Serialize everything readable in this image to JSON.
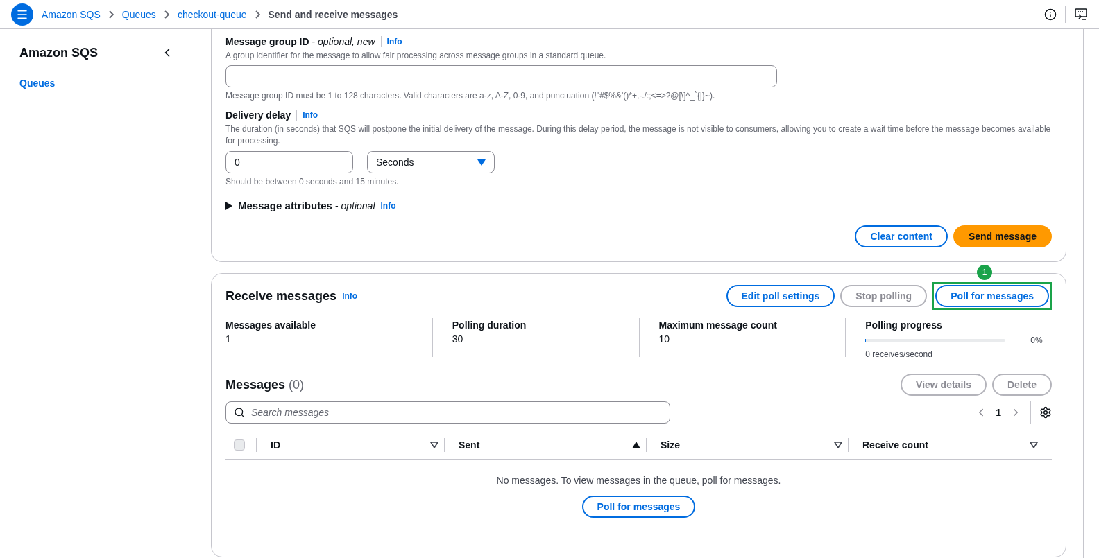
{
  "breadcrumbs": [
    {
      "label": "Amazon SQS",
      "link": true
    },
    {
      "label": "Queues",
      "link": true
    },
    {
      "label": "checkout-queue",
      "link": true
    },
    {
      "label": "Send and receive messages",
      "link": false
    }
  ],
  "sidebar": {
    "title": "Amazon SQS",
    "items": [
      {
        "label": "Queues",
        "selected": true
      }
    ]
  },
  "send_form": {
    "group_id": {
      "label": "Message group ID",
      "qualifier": "- *optional, new*",
      "info": "Info",
      "description": "A group identifier for the message to allow fair processing across message groups in a standard queue.",
      "constraint": "Message group ID must be 1 to 128 characters. Valid characters are a-z, A-Z, 0-9, and punctuation (!\"#$%&'()*+,-./:;<=>?@[\\]^_`{|}~)."
    },
    "delivery_delay": {
      "label": "Delivery delay",
      "info": "Info",
      "description": "The duration (in seconds) that SQS will postpone the initial delivery of the message. During this delay period, the message is not visible to consumers, allowing you to create a wait time before the message becomes available for processing.",
      "value": "0",
      "unit": "Seconds",
      "constraint": "Should be between 0 seconds and 15 minutes."
    },
    "attributes": {
      "label": "Message attributes",
      "qualifier": "- *optional*",
      "info": "Info",
      "expanded": false
    },
    "buttons": [
      {
        "label": "Clear content",
        "kind": "secondary",
        "disabled": false
      },
      {
        "label": "Send message",
        "kind": "primary",
        "disabled": false
      }
    ]
  },
  "receive": {
    "title": "Receive messages",
    "info": "Info",
    "buttons": [
      {
        "label": "Edit poll settings",
        "disabled": false,
        "highlighted": false
      },
      {
        "label": "Stop polling",
        "disabled": true,
        "highlighted": false
      },
      {
        "label": "Poll for messages",
        "disabled": false,
        "highlighted": true,
        "badge": "1"
      }
    ],
    "stats": [
      {
        "label": "Messages available",
        "value": "1"
      },
      {
        "label": "Polling duration",
        "value": "30"
      },
      {
        "label": "Maximum message count",
        "value": "10"
      }
    ],
    "progress": {
      "label": "Polling progress",
      "level": 0,
      "percent": "0%",
      "rate": "0 receives/second"
    }
  },
  "messages": {
    "title": "Messages",
    "count": "(0)",
    "buttons": [
      {
        "label": "View details",
        "disabled": true
      },
      {
        "label": "Delete",
        "disabled": true
      }
    ],
    "search": {
      "placeholder": "Search messages"
    },
    "page": "1",
    "columns": [
      {
        "label": "ID",
        "sorted": false
      },
      {
        "label": "Sent",
        "sorted": true
      },
      {
        "label": "Size",
        "sorted": false
      },
      {
        "label": "Receive count",
        "sorted": false
      }
    ],
    "select_all_checked": false,
    "empty_text": "No messages. To view messages in the queue, poll for messages.",
    "empty_button": "Poll for messages"
  }
}
